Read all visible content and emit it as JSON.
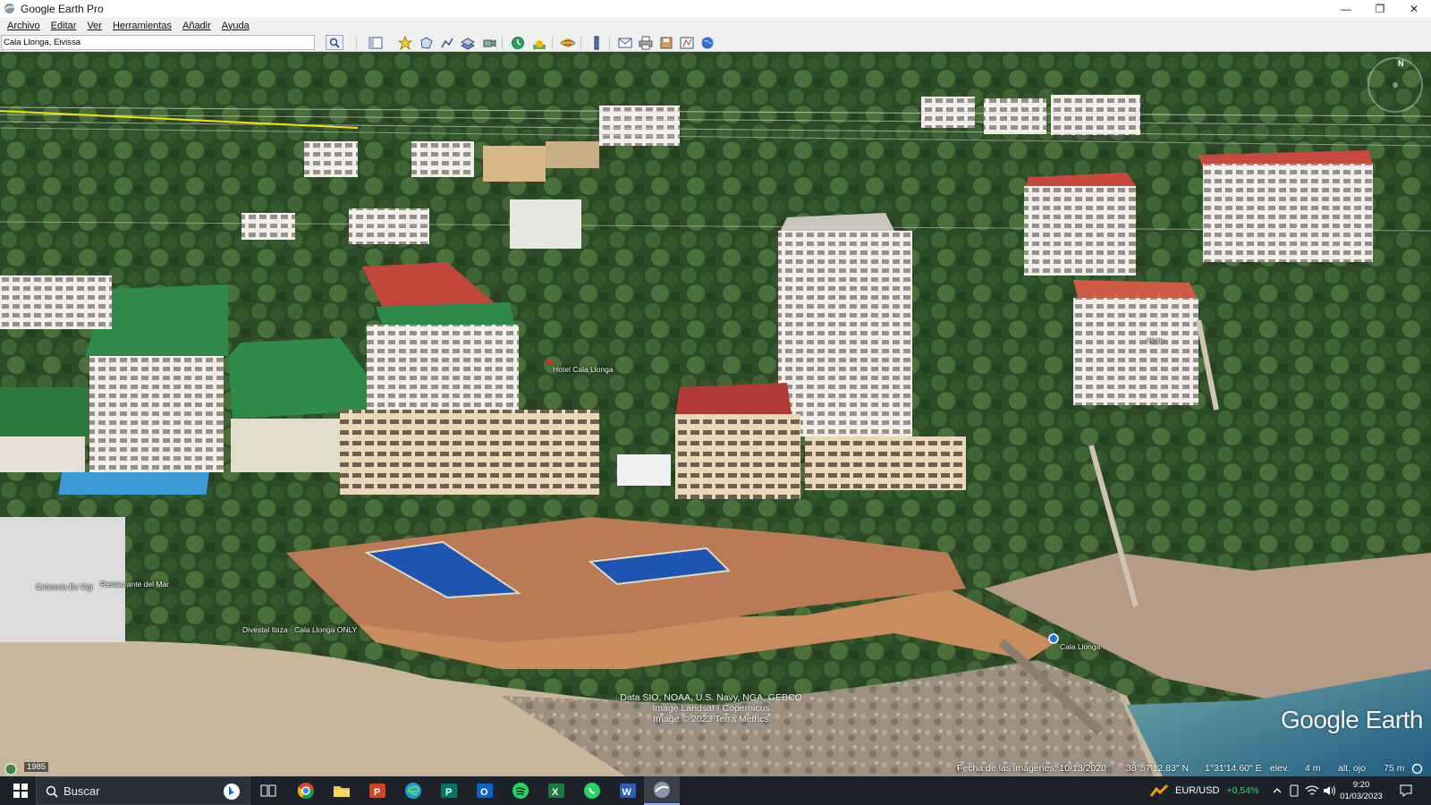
{
  "window": {
    "title": "Google Earth Pro",
    "controls": {
      "minimize": "—",
      "restore": "❐",
      "close": "✕"
    }
  },
  "menu": [
    "Archivo",
    "Editar",
    "Ver",
    "Herramientas",
    "Añadir",
    "Ayuda"
  ],
  "search": {
    "value": "Cala Llonga, Eivissa"
  },
  "toolbar_icons": [
    "search-icon",
    "sidebar-toggle-icon",
    "placemark-icon",
    "polygon-icon",
    "path-icon",
    "image-overlay-icon",
    "record-tour-icon",
    "historical-imagery-icon",
    "sunlight-icon",
    "planets-icon",
    "ruler-icon",
    "email-icon",
    "print-icon",
    "save-image-icon",
    "maps-icon",
    "earth-gallery-icon"
  ],
  "map_labels": {
    "hotel_label": "Hotel Cala Llonga",
    "hotel_small": "Hote",
    "cafeteria": "Cafetería Es Vigi",
    "restaurant": "Restaurante del Mar",
    "diving": "Divestal Ibiza · Cala Llonga ONLY",
    "beach": "Cala Llonga"
  },
  "copyright": {
    "line1": "Data SIO, NOAA, U.S. Navy, NGA, GEBCO",
    "line2": "Image Landsat / Copernicus",
    "line3": "Image © 2023 Terra Metrics"
  },
  "logo": "Google Earth",
  "status": {
    "year": "1985",
    "imagery_date": "Fecha de las imágenes: 10/13/2020",
    "lat": "38°57'12.83\" N",
    "lon": "1°31'14.60\" E",
    "elev_label": "elev.",
    "elev": "4 m",
    "eye_label": "alt. ojo",
    "eye": "75 m"
  },
  "compass_north": "N",
  "taskbar": {
    "search_placeholder": "Buscar",
    "apps": [
      "task-view-icon",
      "chrome-icon",
      "file-explorer-icon",
      "powerpoint-icon",
      "edge-icon",
      "publisher-icon",
      "outlook-icon",
      "spotify-icon",
      "excel-icon",
      "whatsapp-icon",
      "word-icon",
      "google-earth-icon"
    ],
    "ticker_symbol": "EUR/USD",
    "ticker_change": "+0,54%",
    "time": "9:20",
    "date": "01/03/2023"
  },
  "colors": {
    "ticker_up": "#3fd174",
    "taskbar_bg": "#1d2129",
    "path_line": "#f5e20a"
  }
}
